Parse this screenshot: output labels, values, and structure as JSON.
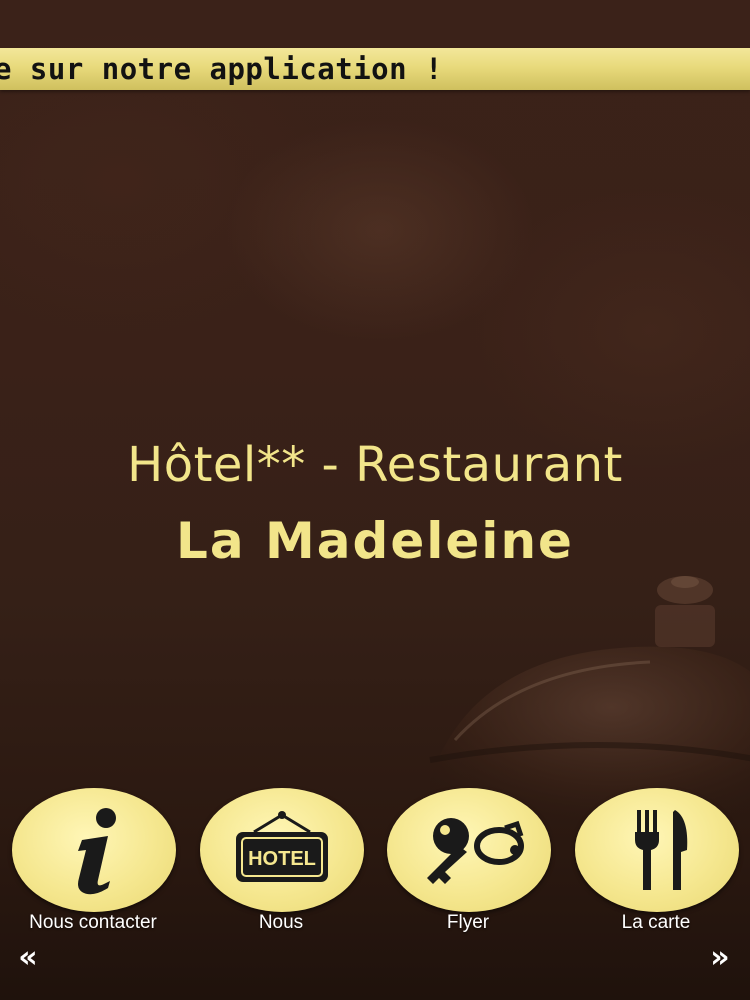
{
  "ticker": {
    "text": "e sur notre application !"
  },
  "hero": {
    "subtitle": "Hôtel** - Restaurant",
    "name": "La Madeleine"
  },
  "nav": {
    "items": [
      {
        "label": "Nous contacter",
        "icon": "info-icon"
      },
      {
        "label": "Nous",
        "icon": "hotel-sign-icon",
        "sign_text": "HOTEL"
      },
      {
        "label": "Flyer",
        "icon": "key-icon"
      },
      {
        "label": "La carte",
        "icon": "fork-knife-icon"
      }
    ],
    "prev": "«",
    "next": "»"
  },
  "colors": {
    "accent": "#f2e58a",
    "button_fill": "#f5e78f",
    "ticker_bg": "#e8da7c",
    "background": "#3a2118",
    "icon": "#1a1a1a"
  }
}
